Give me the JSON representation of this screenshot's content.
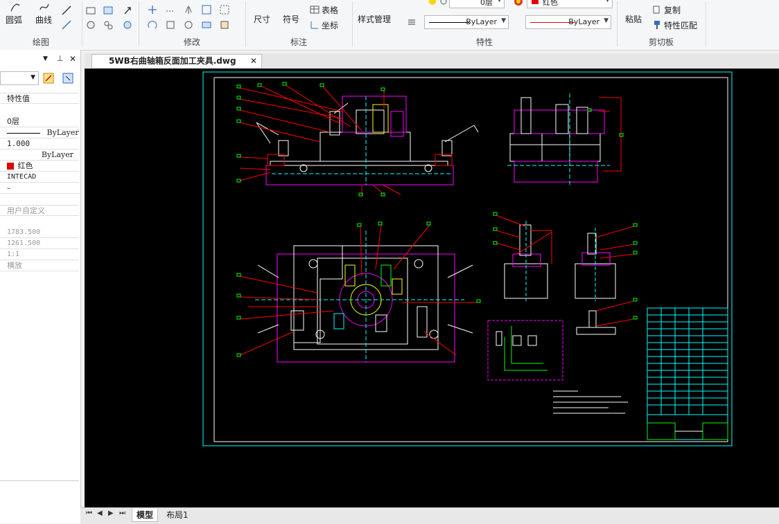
{
  "ribbon": {
    "draw": {
      "arc_label": "圆弧",
      "curve_label": "曲线",
      "group_label": "绘图"
    },
    "modify": {
      "group_label": "修改"
    },
    "annotate": {
      "dimension_label": "尺寸",
      "symbol_label": "符号",
      "table_label": "表格",
      "coord_label": "坐标",
      "group_label": "标注"
    },
    "properties": {
      "style_label": "样式管理",
      "layer_value": "0层",
      "color_value": "红色",
      "linetype_value": "ByLayer",
      "lineweight_value": "ByLayer",
      "group_label": "特性"
    },
    "clipboard": {
      "paste_label": "粘贴",
      "copy_label": "复制",
      "match_label": "特性匹配",
      "group_label": "剪切板"
    }
  },
  "panel": {
    "header_col": "特性值",
    "rows": [
      "0层",
      "ByLayer",
      "1.000",
      "ByLayer",
      "红色",
      "INTECAD",
      "–"
    ],
    "user_section": "用户自定义",
    "gray_rows": [
      "1783.500",
      "1261.500",
      "1:1",
      "横放"
    ]
  },
  "document": {
    "tab_title": "5WB右曲轴箱反面加工夹具.dwg"
  },
  "layout_tabs": {
    "model": "模型",
    "layout1": "布局1"
  },
  "colors": {
    "canvas": "#000000",
    "frame": "#00ffff",
    "part": "#ff00ff",
    "leader": "#ff0000",
    "label": "#00ff00",
    "white": "#ffffff",
    "yellow": "#ffff00"
  }
}
